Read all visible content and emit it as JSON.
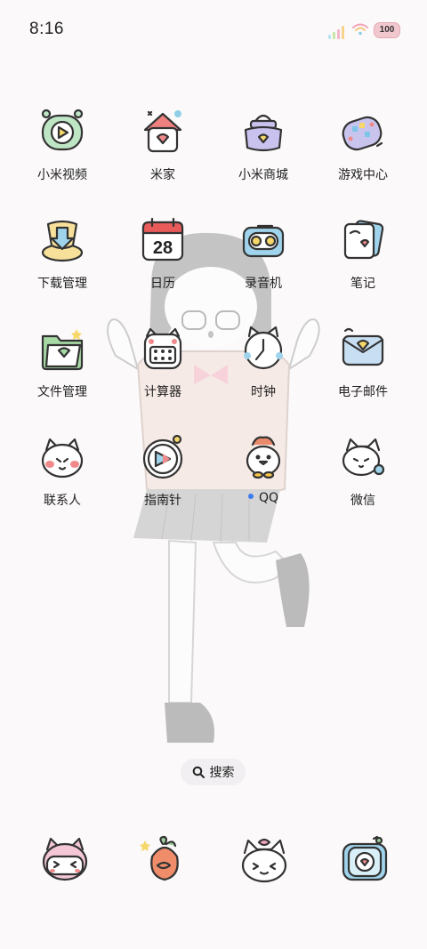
{
  "status_bar": {
    "time": "8:16",
    "battery": "100"
  },
  "apps": [
    {
      "label": "小米视频",
      "icon": "video-player-icon"
    },
    {
      "label": "米家",
      "icon": "smart-home-icon"
    },
    {
      "label": "小米商城",
      "icon": "shopping-bag-icon"
    },
    {
      "label": "游戏中心",
      "icon": "game-controller-icon"
    },
    {
      "label": "下载管理",
      "icon": "download-icon"
    },
    {
      "label": "日历",
      "icon": "calendar-icon",
      "date": "28"
    },
    {
      "label": "录音机",
      "icon": "recorder-icon"
    },
    {
      "label": "笔记",
      "icon": "notes-icon"
    },
    {
      "label": "文件管理",
      "icon": "folder-icon"
    },
    {
      "label": "计算器",
      "icon": "calculator-icon"
    },
    {
      "label": "时钟",
      "icon": "clock-icon"
    },
    {
      "label": "电子邮件",
      "icon": "mail-icon"
    },
    {
      "label": "联系人",
      "icon": "contacts-cat-icon"
    },
    {
      "label": "指南针",
      "icon": "compass-icon"
    },
    {
      "label": "QQ",
      "icon": "qq-penguin-icon"
    },
    {
      "label": "微信",
      "icon": "wechat-cat-icon"
    }
  ],
  "search": {
    "label": "搜索"
  },
  "dock": [
    {
      "icon": "phone-cat-icon"
    },
    {
      "icon": "browser-fruit-icon"
    },
    {
      "icon": "messages-cat-icon"
    },
    {
      "icon": "camera-icon"
    }
  ]
}
